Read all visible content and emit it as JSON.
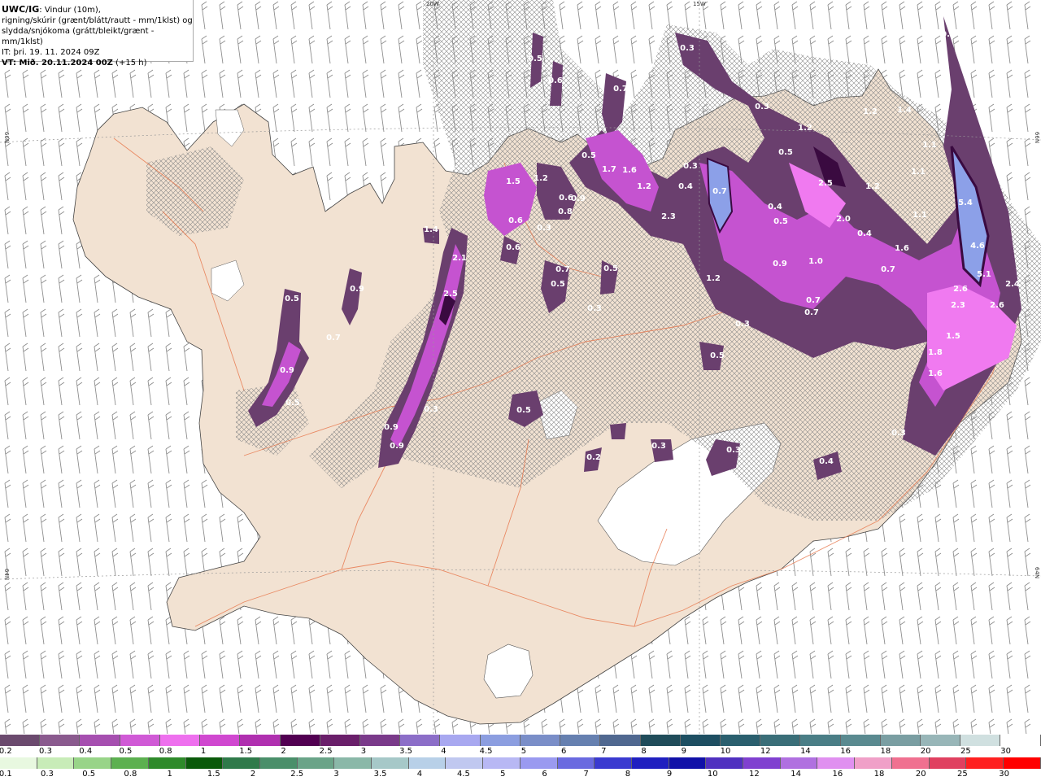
{
  "info": {
    "line1_bold": "UWC/IG",
    "line1_rest": ": Vindur (10m),",
    "line2": "rigning/skúrir (grænt/blátt/rautt - mm/1klst) og",
    "line3": "slydda/snjókoma (grátt/bleikt/grænt - mm/1klst)",
    "line4": "IT: þri. 19. 11. 2024 09Z",
    "line5_bold": "VT: Mið. 20.11.2024 00Z",
    "line5_rest": " (+15 h)"
  },
  "edge_labels": {
    "top_left_lon": "20W",
    "top_right_lon": "15W",
    "left_lat1": "66N",
    "left_lat2": "64N",
    "right_lat1": "66N",
    "right_lat2": "64N"
  },
  "legend_snow": {
    "colors": [
      "#6b4a6e",
      "#8a5a8e",
      "#a64fb0",
      "#d05ad6",
      "#ee70ee",
      "#d048d0",
      "#b030b0",
      "#520052",
      "#6a1f6a",
      "#7a3a8a",
      "#8c6ec8",
      "#a8a8f0",
      "#8c9ee0",
      "#7a8ec8",
      "#6680b0",
      "#506890",
      "#204c5a",
      "#1e4f62",
      "#2a5f6e",
      "#3a6e78",
      "#4a7e86",
      "#5a8a90",
      "#7a9ea2",
      "#98b6b8",
      "#d0e0e0",
      "#ffffff"
    ],
    "labels": [
      "0.2",
      "0.3",
      "0.4",
      "0.5",
      "0.8",
      "1",
      "1.5",
      "2",
      "2.5",
      "3",
      "3.5",
      "4",
      "4.5",
      "5",
      "6",
      "7",
      "8",
      "9",
      "10",
      "12",
      "14",
      "16",
      "18",
      "20",
      "25",
      "30"
    ]
  },
  "legend_rain": {
    "colors": [
      "#e8f8e0",
      "#c8ecb8",
      "#98d488",
      "#5cb050",
      "#2e8a2a",
      "#0a5a0a",
      "#2f7a4a",
      "#4a8f6a",
      "#6aa488",
      "#8ab8a8",
      "#a6c8c8",
      "#b8d0e8",
      "#c0c8f0",
      "#b8b8f4",
      "#9a9af0",
      "#6a6ae0",
      "#3a3ad0",
      "#2020c0",
      "#1010a8",
      "#5030c0",
      "#8040d0",
      "#b070e0",
      "#e090f0",
      "#f0a0c8",
      "#f07090",
      "#e04060",
      "#ff2020",
      "#ff0000"
    ],
    "labels": [
      "0.1",
      "0.3",
      "0.5",
      "0.8",
      "1",
      "1.5",
      "2",
      "2.5",
      "3",
      "3.5",
      "4",
      "4.5",
      "5",
      "6",
      "7",
      "8",
      "9",
      "10",
      "12",
      "14",
      "16",
      "18",
      "20",
      "25",
      "30"
    ]
  },
  "map_labels": [
    "0.3",
    "0.6",
    "0.5",
    "0.7",
    "1.4",
    "0.8",
    "0.3",
    "0.5",
    "1.2",
    "0.4",
    "1.2",
    "2.5",
    "2.0",
    "1.2",
    "1.1",
    "1.1",
    "5.4",
    "4.6",
    "5.1",
    "2.6",
    "2.3",
    "2.4",
    "2.6",
    "1.5",
    "1.8",
    "1.6",
    "0.3",
    "0.7",
    "0.4",
    "0.5",
    "0.9",
    "1.0",
    "0.7",
    "0.7",
    "1.2",
    "0.3",
    "0.5",
    "1.6",
    "0.7",
    "2.3",
    "1.2",
    "1.7",
    "1.6",
    "0.5",
    "0.3",
    "0.4",
    "1.1",
    "1.2",
    "1.5",
    "0.6",
    "0.8",
    "0.6",
    "0.3",
    "0.6",
    "0.9",
    "1.4",
    "2.1",
    "2.5",
    "0.7",
    "0.5",
    "0.5",
    "0.3",
    "0.9",
    "0.5",
    "0.7",
    "0.5",
    "0.9",
    "0.9",
    "0.3",
    "0.9",
    "0.5",
    "0.3",
    "0.3",
    "0.4",
    "0.2",
    "0.3"
  ],
  "colors": {
    "land": "#f2e2d2",
    "roads": "#e87a50",
    "wind_barb": "#888888",
    "snow_light": "#6a3f6e",
    "snow_mid": "#c553d0",
    "snow_bright": "#f07af0",
    "snow_dark": "#3a0a40",
    "blue_core": "#8ca0e8"
  }
}
